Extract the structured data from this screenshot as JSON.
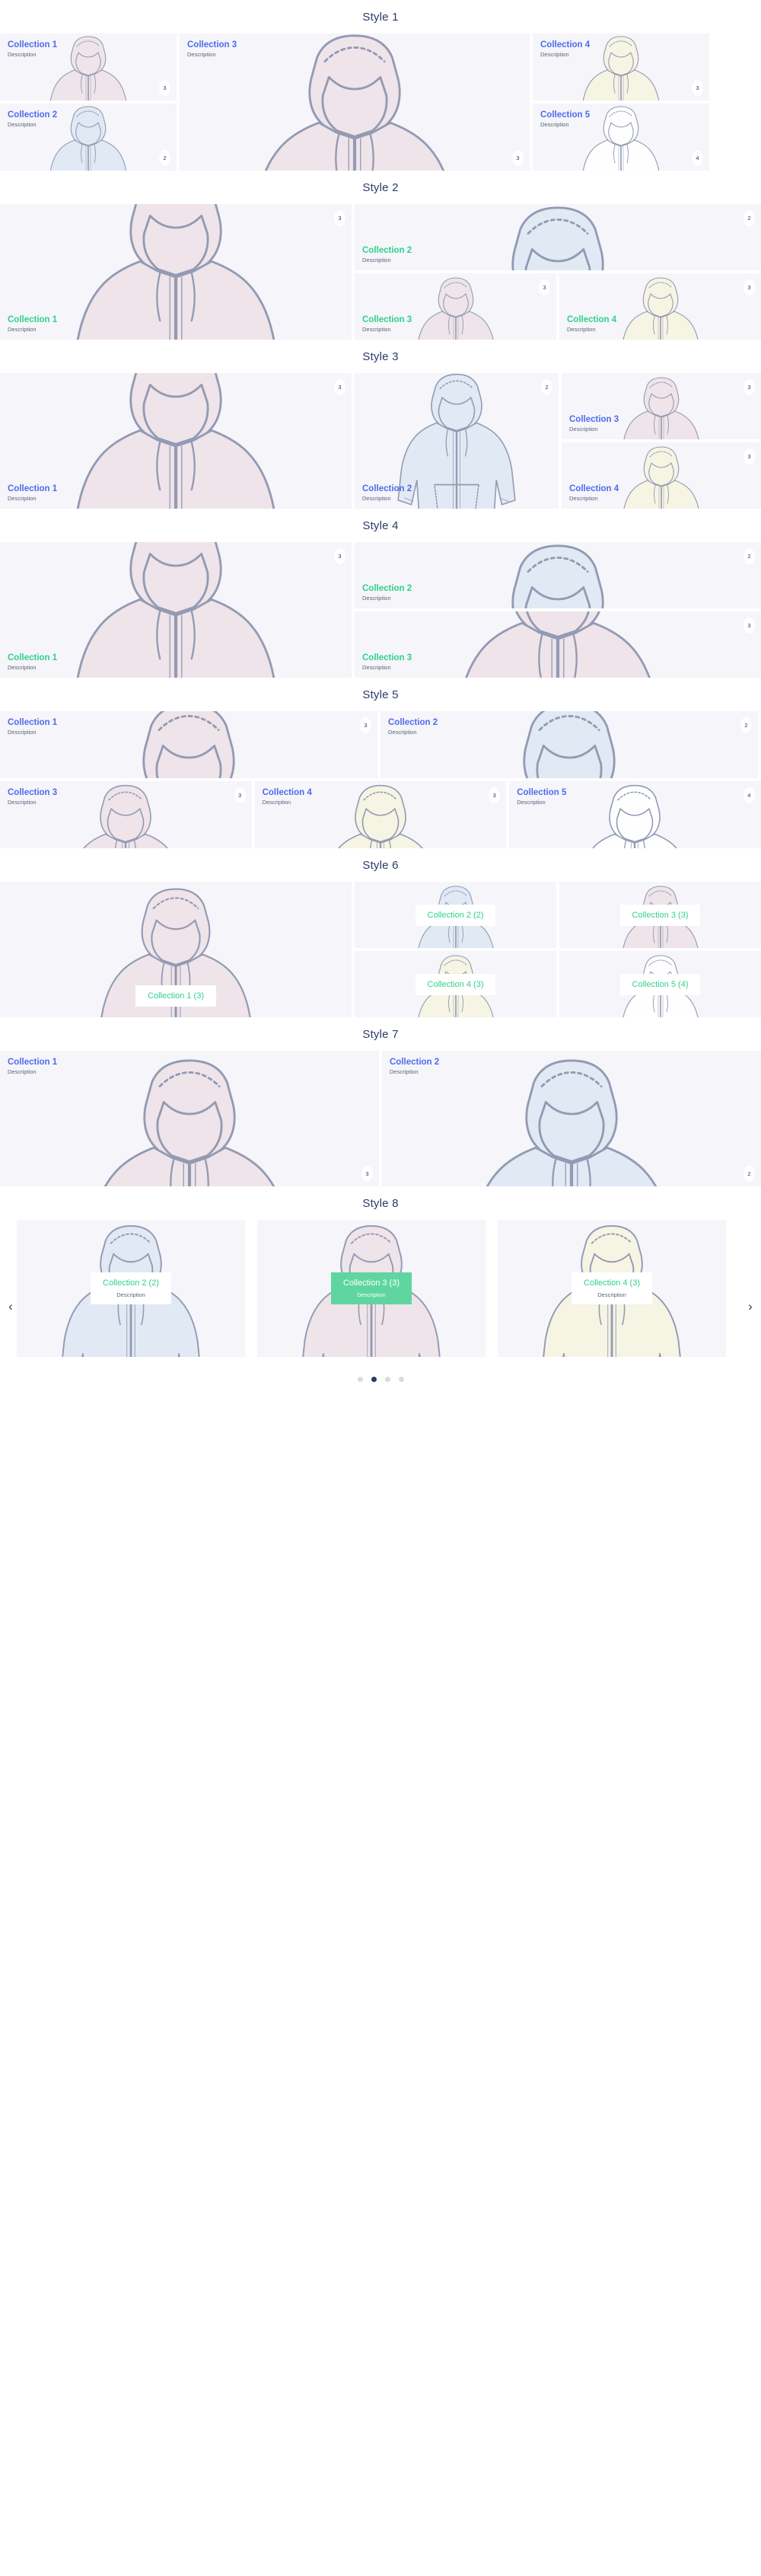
{
  "sections": [
    {
      "id": "style-1",
      "title": "Style 1",
      "label_color": "blue",
      "cards": [
        {
          "name": "Collection 1",
          "desc": "Description",
          "badge": "3",
          "color": "pink"
        },
        {
          "name": "Collection 2",
          "desc": "Description",
          "badge": "2",
          "color": "blue"
        },
        {
          "name": "Collection 3",
          "desc": "Description",
          "badge": "3",
          "color": "pink"
        },
        {
          "name": "Collection 4",
          "desc": "Description",
          "badge": "3",
          "color": "cream"
        },
        {
          "name": "Collection 5",
          "desc": "Description",
          "badge": "4",
          "color": "white"
        }
      ]
    },
    {
      "id": "style-2",
      "title": "Style 2",
      "label_color": "green",
      "cards": [
        {
          "name": "Collection 1",
          "desc": "Description",
          "badge": "3",
          "color": "pink"
        },
        {
          "name": "Collection 2",
          "desc": "Description",
          "badge": "2",
          "color": "blue"
        },
        {
          "name": "Collection 3",
          "desc": "Description",
          "badge": "3",
          "color": "pink"
        },
        {
          "name": "Collection 4",
          "desc": "Description",
          "badge": "3",
          "color": "cream"
        }
      ]
    },
    {
      "id": "style-3",
      "title": "Style 3",
      "label_color": "blue",
      "cards": [
        {
          "name": "Collection 1",
          "desc": "Description",
          "badge": "3",
          "color": "pink"
        },
        {
          "name": "Collection 2",
          "desc": "Description",
          "badge": "2",
          "color": "blue"
        },
        {
          "name": "Collection 3",
          "desc": "Description",
          "badge": "3",
          "color": "pink"
        },
        {
          "name": "Collection 4",
          "desc": "Description",
          "badge": "3",
          "color": "cream"
        }
      ]
    },
    {
      "id": "style-4",
      "title": "Style 4",
      "label_color": "green",
      "cards": [
        {
          "name": "Collection 1",
          "desc": "Description",
          "badge": "3",
          "color": "pink"
        },
        {
          "name": "Collection 2",
          "desc": "Description",
          "badge": "2",
          "color": "blue"
        },
        {
          "name": "Collection 3",
          "desc": "Description",
          "badge": "3",
          "color": "pink"
        }
      ]
    },
    {
      "id": "style-5",
      "title": "Style 5",
      "label_color": "blue",
      "cards": [
        {
          "name": "Collection 1",
          "desc": "Description",
          "badge": "3",
          "color": "pink"
        },
        {
          "name": "Collection 2",
          "desc": "Description",
          "badge": "2",
          "color": "blue"
        },
        {
          "name": "Collection 3",
          "desc": "Description",
          "badge": "3",
          "color": "pink"
        },
        {
          "name": "Collection 4",
          "desc": "Description",
          "badge": "3",
          "color": "cream"
        },
        {
          "name": "Collection 5",
          "desc": "Description",
          "badge": "4",
          "color": "white"
        }
      ]
    },
    {
      "id": "style-6",
      "title": "Style 6",
      "label_color": "green",
      "cards": [
        {
          "name": "Collection 1 (3)",
          "color": "pink"
        },
        {
          "name": "Collection 2 (2)",
          "color": "blue"
        },
        {
          "name": "Collection 3 (3)",
          "color": "pink"
        },
        {
          "name": "Collection 4 (3)",
          "color": "cream"
        },
        {
          "name": "Collection 5 (4)",
          "color": "white"
        }
      ]
    },
    {
      "id": "style-7",
      "title": "Style 7",
      "label_color": "blue",
      "cards": [
        {
          "name": "Collection 1",
          "desc": "Description",
          "badge": "3",
          "color": "pink"
        },
        {
          "name": "Collection 2",
          "desc": "Description",
          "badge": "2",
          "color": "blue"
        }
      ]
    },
    {
      "id": "style-8",
      "title": "Style 8",
      "label_color": "green",
      "prev_icon": "chevron-left",
      "next_icon": "chevron-right",
      "slides": [
        {
          "name": "Collection 2 (2)",
          "desc": "Description",
          "color": "blue",
          "active": false
        },
        {
          "name": "Collection 3 (3)",
          "desc": "Description",
          "color": "pink",
          "active": true
        },
        {
          "name": "Collection 4 (3)",
          "desc": "Description",
          "color": "cream",
          "active": false
        }
      ],
      "dots": [
        {
          "active": false
        },
        {
          "active": true
        },
        {
          "active": false
        },
        {
          "active": false
        }
      ]
    }
  ],
  "palette": {
    "label_blue": "#4f6bed",
    "label_green": "#2fd18b",
    "title_navy": "#2b3a67",
    "card_bg": "#f5f5fa",
    "active_green": "#5fd6a0",
    "desc_gray": "#5b6478",
    "hoodie_pink": "#efe3e8",
    "hoodie_blue": "#e0e8f4",
    "hoodie_cream": "#f7f4e2",
    "hoodie_white": "#ffffff",
    "hoodie_stroke": "#8b93ad"
  }
}
